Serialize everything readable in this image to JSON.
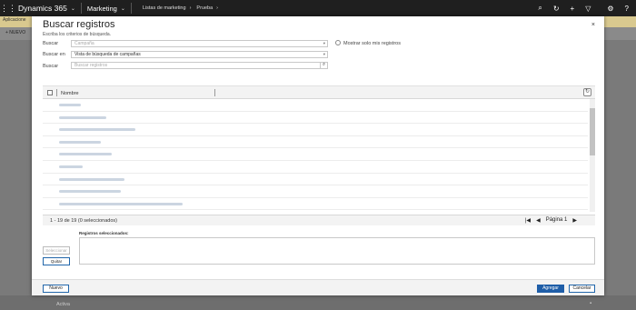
{
  "topbar": {
    "app_name": "Dynamics 365",
    "module": "Marketing",
    "breadcrumb": [
      "Listas de marketing",
      "Prueba"
    ],
    "icons": [
      "search-icon",
      "history-icon",
      "add-icon",
      "filter-icon",
      "settings-icon",
      "help-icon",
      "user-icon"
    ]
  },
  "background": {
    "info_text": "Aplicacione",
    "new_button": "+ NUEVO",
    "status_text": "Activa"
  },
  "dialog": {
    "title": "Buscar registros",
    "subtitle": "Escriba los criterios de búsqueda.",
    "close_label": "×",
    "fields": {
      "buscar_label": "Buscar",
      "buscar_value": "Campaña",
      "buscar_en_label": "Buscar en",
      "buscar_en_value": "Vista de búsqueda de campañas",
      "buscar_text_label": "Buscar",
      "buscar_text_placeholder": "Buscar registros",
      "only_mine_label": "Mostrar solo mis registros"
    },
    "grid": {
      "column_name": "Nombre",
      "row_count": 9,
      "pager_text": "1 - 19 de 19 (0 seleccionados)",
      "page_label": "Página 1"
    },
    "selected": {
      "label": "Registros seleccionados:",
      "select_button": "Seleccionar",
      "remove_button": "Quitar"
    },
    "footer": {
      "new_button": "Nuevo",
      "add_button": "Agregar",
      "cancel_button": "Cancelar"
    }
  },
  "colors": {
    "topbar": "#1f1f1f",
    "primary_button": "#1f5ea8",
    "overlay": "#7a7a7a"
  }
}
